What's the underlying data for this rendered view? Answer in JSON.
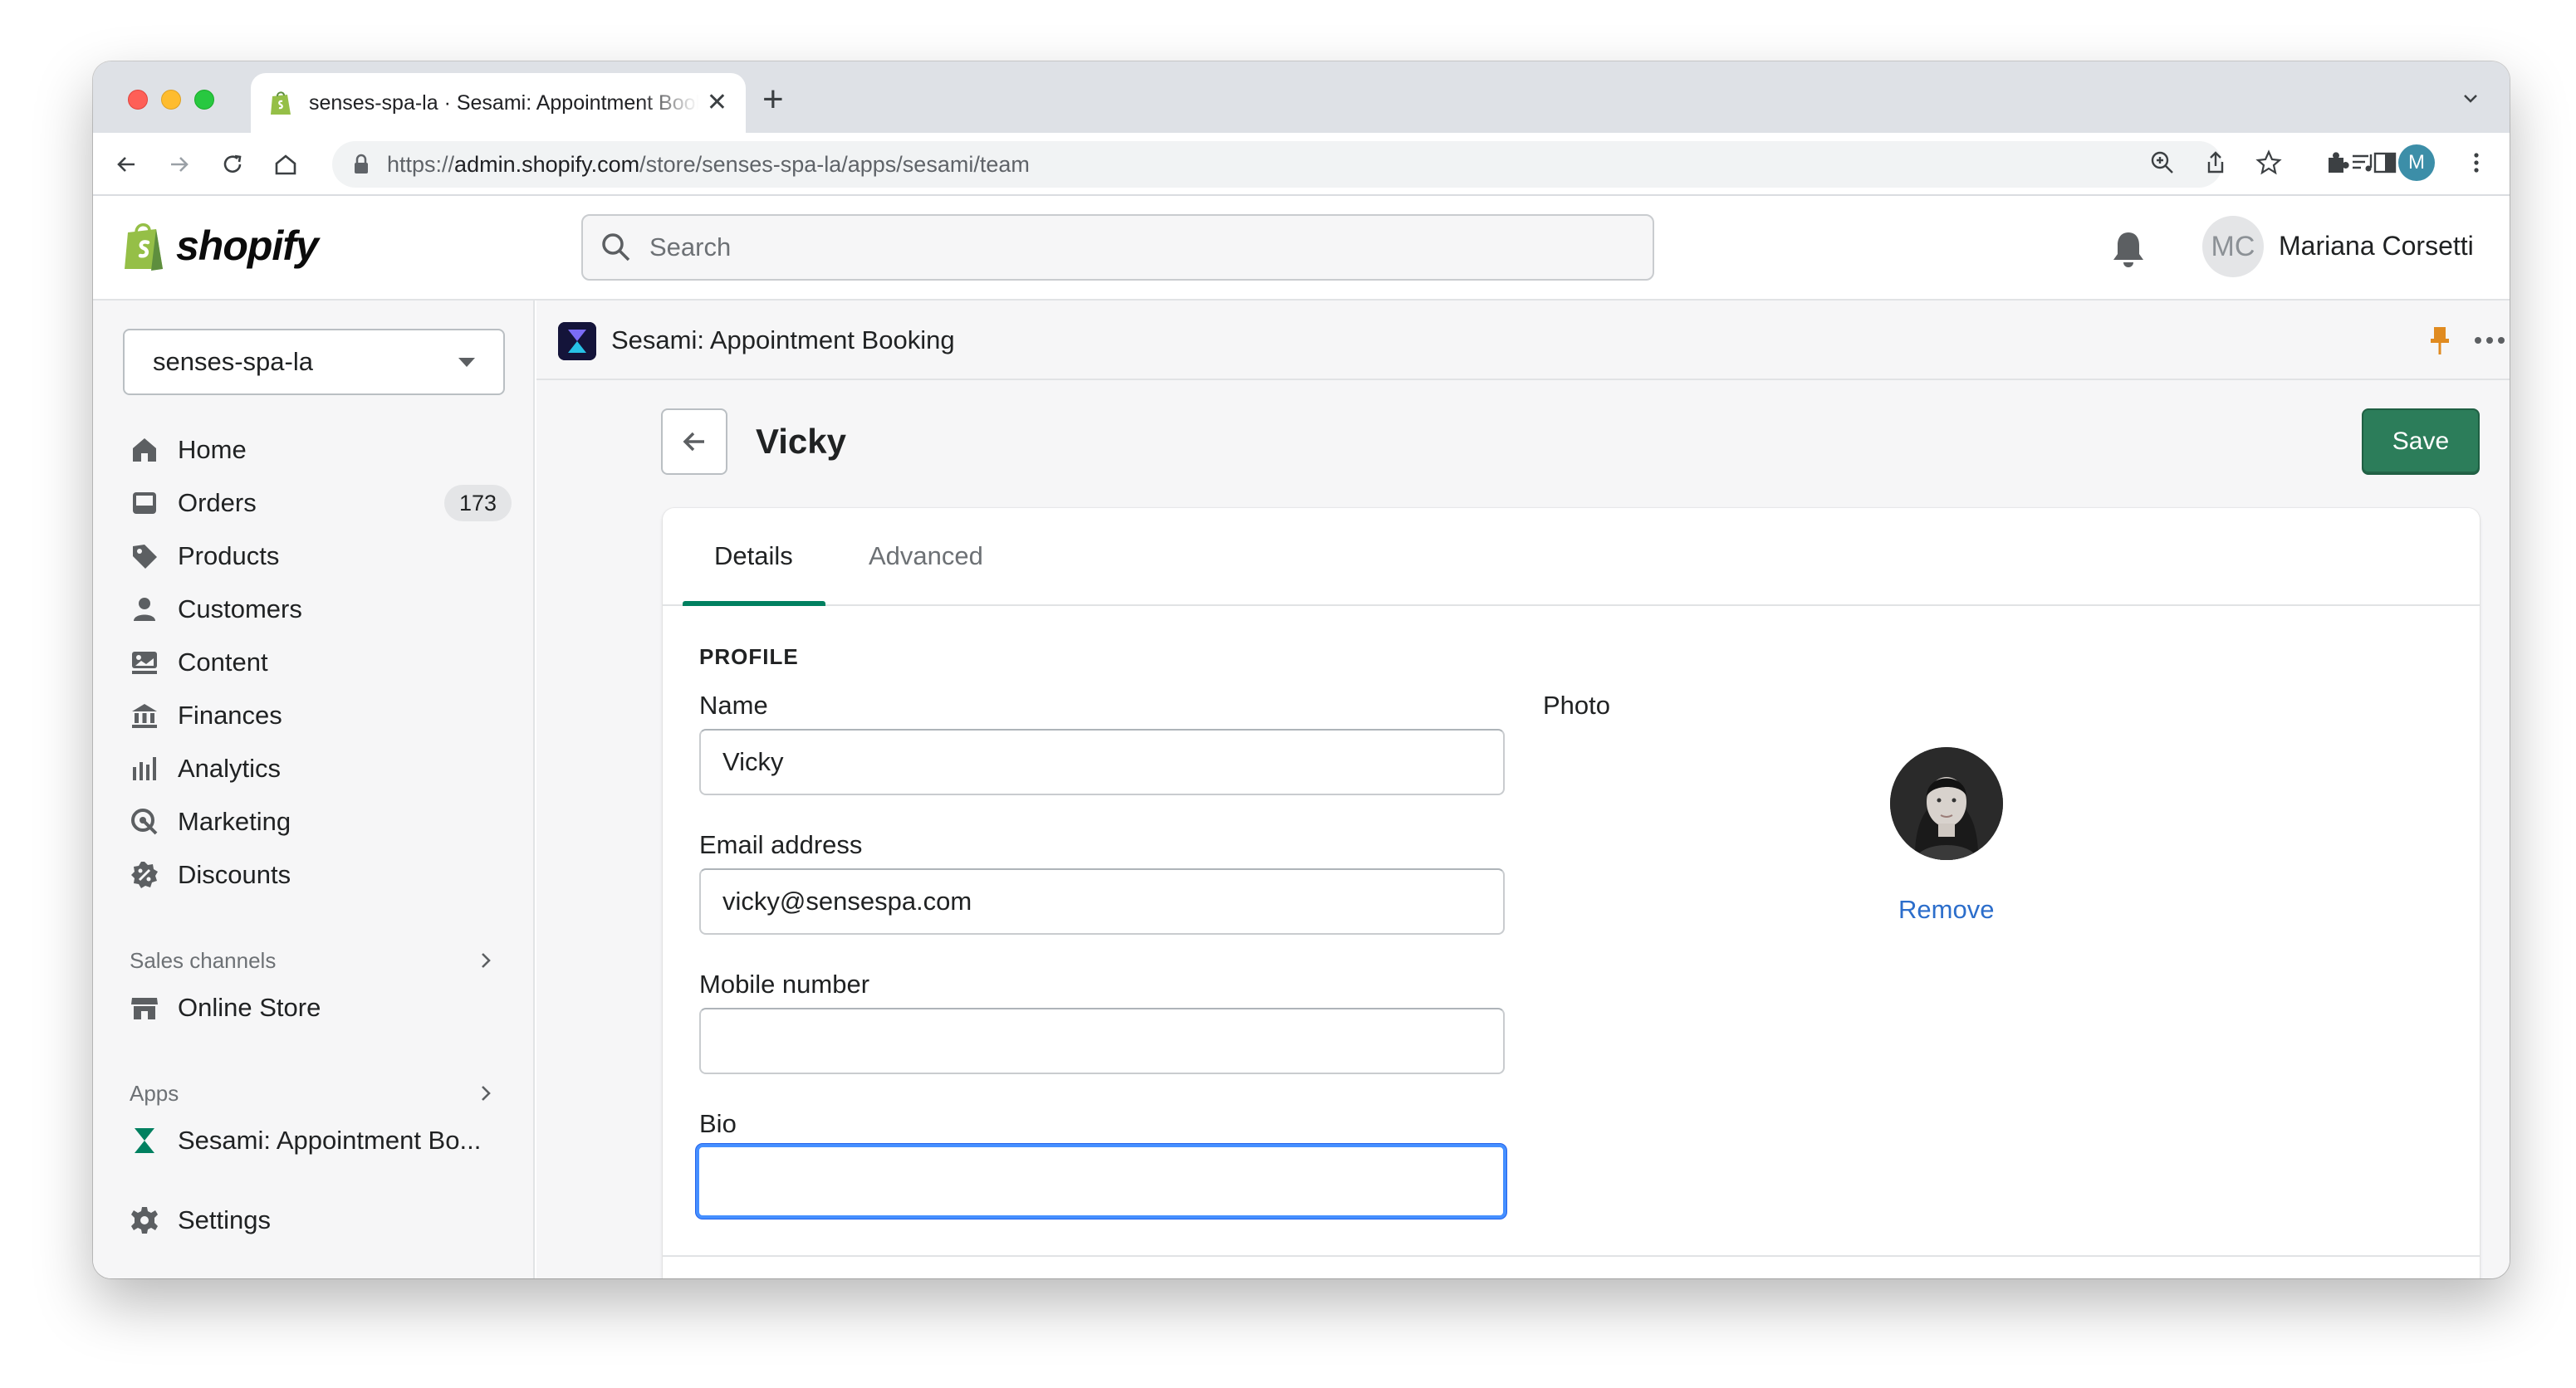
{
  "browser": {
    "tab_title": "senses-spa-la · Sesami: Appointment Booking",
    "url_scheme": "https://",
    "url_host": "admin.shopify.com",
    "url_path": "/store/senses-spa-la/apps/sesami/team",
    "new_tab_label": "+",
    "close_label": "✕",
    "profile_initial": "M"
  },
  "topbar": {
    "brand": "shopify",
    "search_placeholder": "Search",
    "user_initials": "MC",
    "user_name": "Mariana Corsetti"
  },
  "sidebar": {
    "store_name": "senses-spa-la",
    "items": [
      {
        "label": "Home",
        "icon": "home-icon"
      },
      {
        "label": "Orders",
        "icon": "orders-icon",
        "badge": "173"
      },
      {
        "label": "Products",
        "icon": "tag-icon"
      },
      {
        "label": "Customers",
        "icon": "person-icon"
      },
      {
        "label": "Content",
        "icon": "content-icon"
      },
      {
        "label": "Finances",
        "icon": "bank-icon"
      },
      {
        "label": "Analytics",
        "icon": "bar-chart-icon"
      },
      {
        "label": "Marketing",
        "icon": "target-icon"
      },
      {
        "label": "Discounts",
        "icon": "discount-icon"
      }
    ],
    "sales_channels_label": "Sales channels",
    "sales_channels": [
      {
        "label": "Online Store",
        "icon": "store-icon"
      }
    ],
    "apps_label": "Apps",
    "apps": [
      {
        "label": "Sesami: Appointment Bo...",
        "icon": "sesami-icon"
      }
    ],
    "settings_label": "Settings"
  },
  "app": {
    "name": "Sesami: Appointment Booking",
    "page_title": "Vicky",
    "save_label": "Save",
    "tabs": [
      {
        "label": "Details",
        "active": true
      },
      {
        "label": "Advanced",
        "active": false
      }
    ],
    "profile_heading": "PROFILE",
    "name_label": "Name",
    "name_value": "Vicky",
    "email_label": "Email address",
    "email_value": "vicky@sensespa.com",
    "mobile_label": "Mobile number",
    "mobile_value": "",
    "bio_label": "Bio",
    "bio_value": "",
    "photo_label": "Photo",
    "remove_label": "Remove"
  },
  "colors": {
    "accent_green": "#008060",
    "save_green": "#2c7d5a",
    "link_blue": "#2c6ecb",
    "focus_blue": "#458fff"
  }
}
